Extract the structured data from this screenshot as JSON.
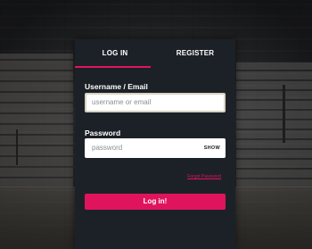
{
  "tabs": [
    {
      "label": "LOG IN",
      "active": true
    },
    {
      "label": "REGISTER",
      "active": false
    }
  ],
  "form": {
    "username_label": "Username / Email",
    "username_placeholder": "username or email",
    "username_value": "",
    "password_label": "Password",
    "password_placeholder": "password",
    "password_value": "",
    "show_label": "SHOW",
    "forgot_label": "Forgot Password",
    "submit_label": "Log in!"
  },
  "colors": {
    "accent": "#e0145c",
    "panel": "#1c2127"
  }
}
